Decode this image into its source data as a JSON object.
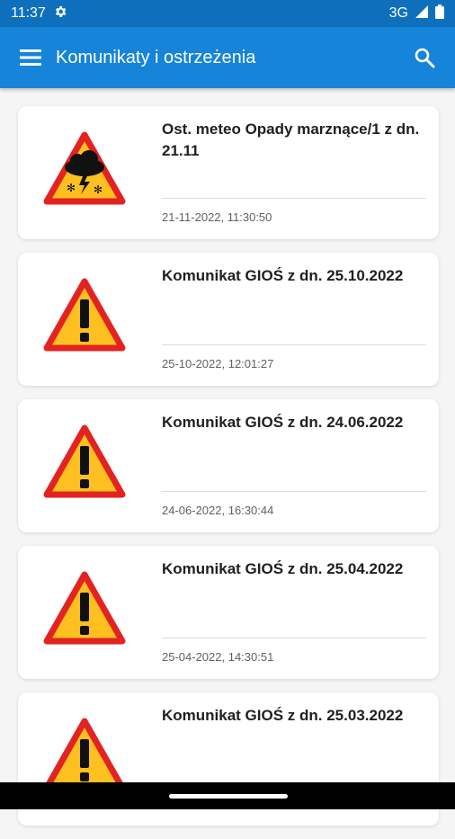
{
  "status_bar": {
    "time": "11:37",
    "network": "3G"
  },
  "app_bar": {
    "title": "Komunikaty i ostrzeżenia"
  },
  "items": [
    {
      "title": "Ost. meteo Opady marznące/1 z dn. 21.11",
      "date": "21-11-2022, 11:30:50",
      "icon": "storm-warning-icon"
    },
    {
      "title": "Komunikat GIOŚ z dn. 25.10.2022",
      "date": "25-10-2022, 12:01:27",
      "icon": "warning-icon"
    },
    {
      "title": "Komunikat GIOŚ z dn. 24.06.2022",
      "date": "24-06-2022, 16:30:44",
      "icon": "warning-icon"
    },
    {
      "title": "Komunikat GIOŚ z dn. 25.04.2022",
      "date": "25-04-2022, 14:30:51",
      "icon": "warning-icon"
    },
    {
      "title": "Komunikat GIOŚ z dn. 25.03.2022",
      "date": "",
      "icon": "warning-icon"
    }
  ],
  "colors": {
    "app_bar": "#1584d9",
    "status_bar": "#0e70bd",
    "warning_fill": "#fdc020",
    "warning_border": "#e32222"
  }
}
